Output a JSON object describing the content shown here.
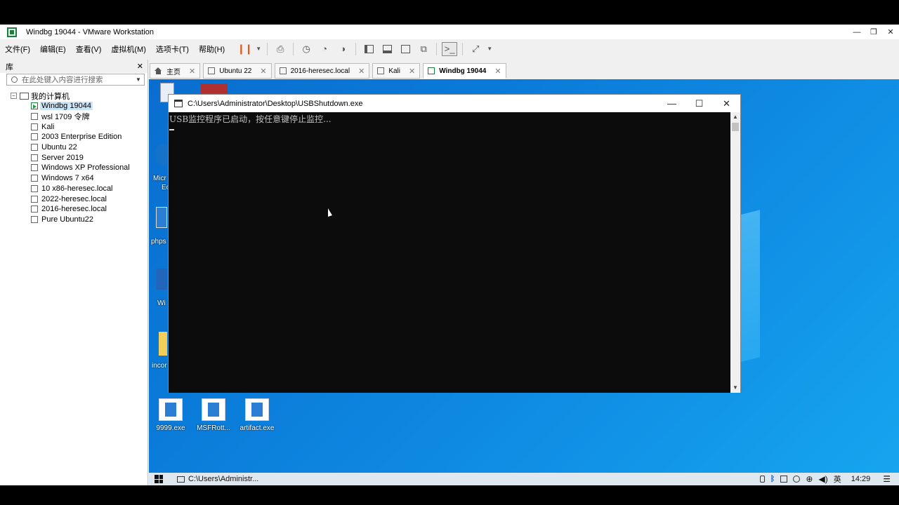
{
  "window": {
    "title": "Windbg 19044 - VMware Workstation"
  },
  "menus": [
    "文件(F)",
    "编辑(E)",
    "查看(V)",
    "虚拟机(M)",
    "选项卡(T)",
    "帮助(H)"
  ],
  "library": {
    "title": "库",
    "search_placeholder": "在此处键入内容进行搜索",
    "root": "我的计算机",
    "items": [
      {
        "label": "Windbg 19044",
        "selected": true,
        "running": true
      },
      {
        "label": "wsl 1709 令牌"
      },
      {
        "label": "Kali"
      },
      {
        "label": "2003 Enterprise Edition"
      },
      {
        "label": "Ubuntu 22"
      },
      {
        "label": "Server 2019"
      },
      {
        "label": "Windows XP Professional"
      },
      {
        "label": "Windows 7 x64"
      },
      {
        "label": "10 x86-heresec.local"
      },
      {
        "label": "2022-heresec.local"
      },
      {
        "label": "2016-heresec.local"
      },
      {
        "label": "Pure Ubuntu22"
      }
    ]
  },
  "tabs": [
    {
      "label": "主页",
      "icon": "home-icon"
    },
    {
      "label": "Ubuntu 22"
    },
    {
      "label": "2016-heresec.local"
    },
    {
      "label": "Kali"
    },
    {
      "label": "Windbg 19044",
      "active": true
    }
  ],
  "console": {
    "title": "C:\\Users\\Administrator\\Desktop\\USBShutdown.exe",
    "output": "USB监控程序已启动，按任意键停止监控..."
  },
  "desktop": {
    "icons": [
      {
        "label": "9999.exe"
      },
      {
        "label": "MSFRott..."
      },
      {
        "label": "artifact.exe"
      }
    ],
    "partial_labels": [
      "Micr",
      "Ec",
      "phps",
      "Wi",
      "incor"
    ]
  },
  "taskbar": {
    "task": "C:\\Users\\Administr...",
    "ime": "英",
    "time": "14:29"
  }
}
